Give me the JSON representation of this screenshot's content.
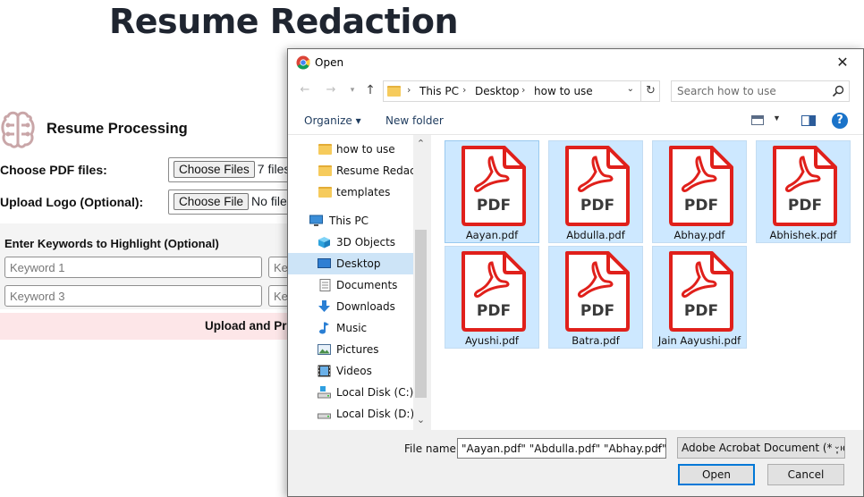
{
  "page": {
    "title": "Resume Redaction",
    "section_title": "Resume Processing",
    "choose_pdf_label": "Choose PDF files:",
    "choose_files_button": "Choose Files",
    "choose_files_status": "7 files",
    "upload_logo_label": "Upload Logo (Optional):",
    "choose_file_button": "Choose File",
    "choose_file_status": "No file c",
    "keywords_heading": "Enter Keywords to Highlight (Optional)",
    "keyword_placeholders": [
      "Keyword 1",
      "Ke",
      "Keyword 3",
      "Ke"
    ],
    "upload_button": "Upload and Pro"
  },
  "dialog": {
    "title": "Open",
    "close": "✕",
    "breadcrumb": [
      "This PC",
      "Desktop",
      "how to use"
    ],
    "search_placeholder": "Search how to use",
    "organize": "Organize ▾",
    "new_folder": "New folder",
    "help": "?",
    "sidebar": [
      {
        "label": "how to use",
        "icon": "folder-icon"
      },
      {
        "label": "Resume Redacto",
        "icon": "folder-icon"
      },
      {
        "label": "templates",
        "icon": "folder-icon"
      },
      {
        "label": "This PC",
        "icon": "pc-icon"
      },
      {
        "label": "3D Objects",
        "icon": "cube-icon"
      },
      {
        "label": "Desktop",
        "icon": "desktop-icon",
        "selected": true
      },
      {
        "label": "Documents",
        "icon": "documents-icon"
      },
      {
        "label": "Downloads",
        "icon": "downloads-icon"
      },
      {
        "label": "Music",
        "icon": "music-icon"
      },
      {
        "label": "Pictures",
        "icon": "pictures-icon"
      },
      {
        "label": "Videos",
        "icon": "videos-icon"
      },
      {
        "label": "Local Disk (C:)",
        "icon": "disk-icon"
      },
      {
        "label": "Local Disk (D:)",
        "icon": "disk-icon"
      }
    ],
    "files": [
      {
        "name": "Aayan.pdf",
        "icon_text": "PDF"
      },
      {
        "name": "Abdulla.pdf",
        "icon_text": "PDF"
      },
      {
        "name": "Abhay.pdf",
        "icon_text": "PDF"
      },
      {
        "name": "Abhishek.pdf",
        "icon_text": "PDF"
      },
      {
        "name": "Ayushi.pdf",
        "icon_text": "PDF"
      },
      {
        "name": "Batra.pdf",
        "icon_text": "PDF"
      },
      {
        "name": "Jain Aayushi.pdf",
        "icon_text": "PDF"
      }
    ],
    "file_name_label": "File name:",
    "file_name_value": "\"Aayan.pdf\" \"Abdulla.pdf\" \"Abhay.pdf\"",
    "file_type": "Adobe Acrobat Document (*.pdf)",
    "open_button": "Open",
    "cancel_button": "Cancel"
  },
  "colors": {
    "pdf_red": "#e0201b",
    "selection": "#cde8ff",
    "accent": "#0078d7"
  }
}
